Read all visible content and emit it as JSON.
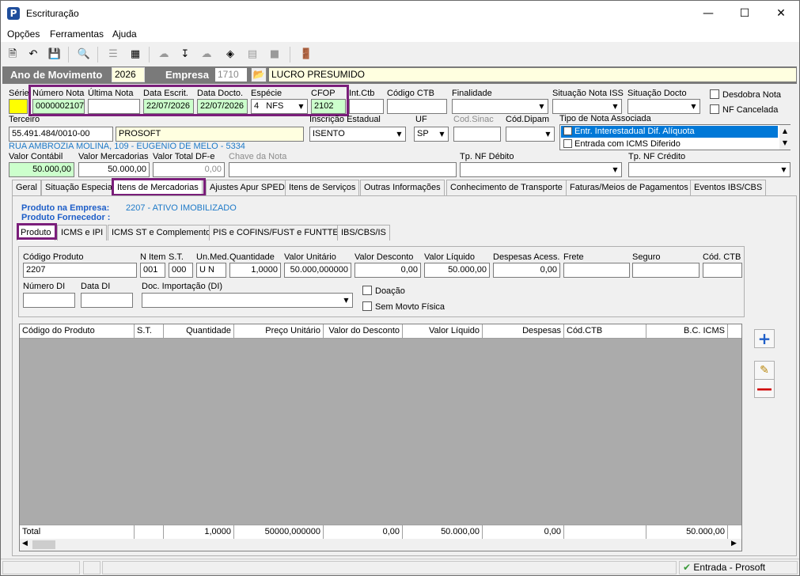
{
  "window": {
    "title": "Escrituração",
    "app_icon": "P"
  },
  "menu": [
    "Opções",
    "Ferramentas",
    "Ajuda"
  ],
  "year": {
    "label": "Ano de Movimento",
    "value": "2026",
    "company_label": "Empresa",
    "company_code": "1710",
    "company_name": "LUCRO PRESUMIDO"
  },
  "nota": {
    "serie_label": "Série",
    "numero_label": "Número Nota",
    "numero": "0000002107",
    "ultima_label": "Última Nota",
    "ultima": "",
    "data_escrit_label": "Data Escrit.",
    "data_escrit": "22/07/2026",
    "data_docto_label": "Data Docto.",
    "data_docto": "22/07/2026",
    "especie_label": "Espécie",
    "especie_num": "4",
    "especie": "NFS",
    "cfop_label": "CFOP",
    "cfop": "2102",
    "intctb_label": "Int.Ctb",
    "codctb_label": "Código CTB",
    "finalidade_label": "Finalidade",
    "sitiss_label": "Situação Nota ISS",
    "sitdocto_label": "Situação Docto",
    "desdobra_label": "Desdobra Nota",
    "cancelada_label": "NF Cancelada"
  },
  "terceiro": {
    "label": "Terceiro",
    "cnpj": "55.491.484/0010-00",
    "name": "PROSOFT",
    "address": "RUA AMBROZIA MOLINA, 109 - EUGENIO DE MELO - 5334",
    "ie_label": "Inscrição Estadual",
    "ie": "ISENTO",
    "uf_label": "UF",
    "uf": "SP",
    "sinac_label": "Cod.Sinac",
    "dipam_label": "Cód.Dipam",
    "tipo_label": "Tipo de Nota Associada",
    "tipo_options": [
      "Entr. Interestadual Dif. Alíquota",
      "Entrada com ICMS Diferido"
    ]
  },
  "valores": {
    "contabil_label": "Valor Contábil",
    "contabil": "50.000,00",
    "mercadorias_label": "Valor Mercadorias",
    "mercadorias": "50.000,00",
    "dfe_label": "Valor Total DF-e",
    "dfe": "0,00",
    "chave_label": "Chave da Nota",
    "debito_label": "Tp. NF Débito",
    "credito_label": "Tp. NF Crédito"
  },
  "tabs": [
    "Geral",
    "Situação Especial",
    "Itens de Mercadorias",
    "Ajustes Apur SPED",
    "Itens de Serviços",
    "Outras Informações",
    "Conhecimento de Transporte",
    "Faturas/Meios de Pagamentos",
    "Eventos IBS/CBS"
  ],
  "produto_info": {
    "empresa_label": "Produto na Empresa:",
    "empresa": "2207 - ATIVO IMOBILIZADO",
    "fornecedor_label": "Produto Fornecedor :"
  },
  "subtabs": [
    "Produto",
    "ICMS e IPI",
    "ICMS ST e Complemento",
    "PIS e COFINS/FUST e FUNTTEL",
    "IBS/CBS/IS"
  ],
  "produto": {
    "codigo_label": "Código Produto",
    "codigo": "2207",
    "nitem_label": "N Item",
    "nitem": "001",
    "st_label": "S.T.",
    "st": "000",
    "unmed_label": "Un.Med.",
    "unmed": "U N",
    "qtd_label": "Quantidade",
    "qtd": "1,0000",
    "vunit_label": "Valor Unitário",
    "vunit": "50.000,000000",
    "vdesc_label": "Valor Desconto",
    "vdesc": "0,00",
    "vliq_label": "Valor Líquido",
    "vliq": "50.000,00",
    "desp_label": "Despesas Acess.",
    "desp": "0,00",
    "frete_label": "Frete",
    "seguro_label": "Seguro",
    "codctb_label": "Cód. CTB",
    "numdi_label": "Número DI",
    "datadi_label": "Data DI",
    "docimp_label": "Doc. Importação (DI)",
    "doacao_label": "Doação",
    "semmovto_label": "Sem Movto Física"
  },
  "grid": {
    "headers": [
      "Código do Produto",
      "S.T.",
      "Quantidade",
      "Preço Unitário",
      "Valor do Desconto",
      "Valor Líquido",
      "Despesas",
      "Cód.CTB",
      "B.C. ICMS"
    ],
    "totals": [
      "Total",
      "",
      "1,0000",
      "50000,000000",
      "0,00",
      "50.000,00",
      "0,00",
      "",
      "50.000,00"
    ]
  },
  "status": {
    "text": "Entrada - Prosoft"
  }
}
